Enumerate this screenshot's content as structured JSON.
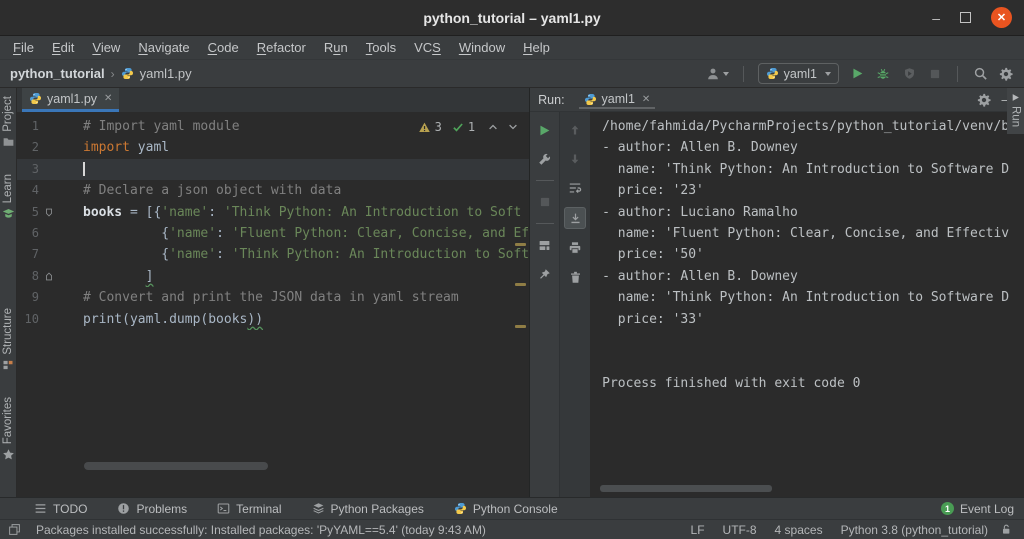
{
  "window": {
    "title": "python_tutorial – yaml1.py"
  },
  "icons_text": {
    "close": "✕",
    "win_min": "–",
    "win_close": "✕",
    "minimize": "—"
  },
  "colors": {
    "accent_blue": "#3a76b8",
    "ubuntu_orange": "#e95420",
    "run_green": "#59a869",
    "keyword_orange": "#cc7832",
    "string_green": "#6a8759",
    "comment_gray": "#808080",
    "warning_tan": "#b8a14f",
    "event_green": "#499c54"
  },
  "menu": {
    "items": [
      {
        "label": "File",
        "mnemonic_index": 0
      },
      {
        "label": "Edit",
        "mnemonic_index": 0
      },
      {
        "label": "View",
        "mnemonic_index": 0
      },
      {
        "label": "Navigate",
        "mnemonic_index": 0
      },
      {
        "label": "Code",
        "mnemonic_index": 0
      },
      {
        "label": "Refactor",
        "mnemonic_index": 0
      },
      {
        "label": "Run",
        "mnemonic_index": 1
      },
      {
        "label": "Tools",
        "mnemonic_index": 0
      },
      {
        "label": "VCS",
        "mnemonic_index": 2
      },
      {
        "label": "Window",
        "mnemonic_index": 0
      },
      {
        "label": "Help",
        "mnemonic_index": 0
      }
    ]
  },
  "toolbar": {
    "breadcrumb_project": "python_tutorial",
    "breadcrumb_separator": "›",
    "breadcrumb_file": "yaml1.py",
    "run_config": "yaml1"
  },
  "left_stripe": {
    "top": [
      {
        "icon": "folder",
        "label": "Project"
      },
      {
        "icon": "learn",
        "label": "Learn"
      }
    ],
    "bottom": [
      {
        "icon": "structure",
        "label": "Structure"
      },
      {
        "icon": "star",
        "label": "Favorites"
      }
    ]
  },
  "right_stripe": {
    "icon": "run-play-small",
    "label": "Run"
  },
  "editor": {
    "tab": "yaml1.py",
    "inspections": {
      "warnings": "3",
      "typos": "1"
    },
    "lines": [
      {
        "n": "1",
        "seg": [
          [
            "comment",
            "# Import yaml module"
          ]
        ]
      },
      {
        "n": "2",
        "seg": [
          [
            "keyword",
            "import"
          ],
          [
            "text",
            " yaml"
          ]
        ]
      },
      {
        "n": "3",
        "seg": [],
        "caret": true
      },
      {
        "n": "4",
        "seg": [
          [
            "comment",
            "# Declare a json object with data"
          ]
        ]
      },
      {
        "n": "5",
        "seg": [
          [
            "ident",
            "books"
          ],
          [
            "text",
            " = [{"
          ],
          [
            "string",
            "'name'"
          ],
          [
            "text",
            ": "
          ],
          [
            "string",
            "'Think Python: An Introduction to Soft"
          ]
        ],
        "fold": "start"
      },
      {
        "n": "6",
        "seg": [
          [
            "text",
            "          {"
          ],
          [
            "string",
            "'name'"
          ],
          [
            "text",
            ": "
          ],
          [
            "string",
            "'Fluent Python: Clear, Concise, and Ef"
          ]
        ]
      },
      {
        "n": "7",
        "seg": [
          [
            "text",
            "          {"
          ],
          [
            "string",
            "'name'"
          ],
          [
            "text",
            ": "
          ],
          [
            "string",
            "'Think Python: An Introduction to Soft"
          ]
        ]
      },
      {
        "n": "8",
        "seg": [
          [
            "text",
            "        "
          ],
          [
            "typo",
            "]"
          ]
        ],
        "fold": "end"
      },
      {
        "n": "9",
        "seg": [
          [
            "comment",
            "# Convert and print the JSON data in yaml stream"
          ]
        ]
      },
      {
        "n": "10",
        "seg": [
          [
            "text",
            "print(yaml.dump(books"
          ],
          [
            "typo",
            "))"
          ]
        ]
      }
    ]
  },
  "run_panel": {
    "label": "Run:",
    "tab": "yaml1",
    "toolbar_main": [
      {
        "icon": "rerun"
      },
      {
        "icon": "wrench"
      },
      {
        "divider": true
      },
      {
        "icon": "stop",
        "disabled": true
      },
      {
        "divider": true
      },
      {
        "icon": "restore-layout"
      },
      {
        "icon": "pin"
      }
    ],
    "toolbar_console": [
      {
        "icon": "arrow-up",
        "disabled": true
      },
      {
        "icon": "arrow-down",
        "disabled": true
      },
      {
        "icon": "soft-wrap"
      },
      {
        "icon": "scroll-end",
        "selected": true
      },
      {
        "icon": "print"
      },
      {
        "icon": "clear"
      }
    ],
    "output": [
      "/home/fahmida/PycharmProjects/python_tutorial/venv/b",
      "- author: Allen B. Downey",
      "  name: 'Think Python: An Introduction to Software D",
      "  price: '23'",
      "- author: Luciano Ramalho",
      "  name: 'Fluent Python: Clear, Concise, and Effectiv",
      "  price: '50'",
      "- author: Allen B. Downey",
      "  name: 'Think Python: An Introduction to Software D",
      "  price: '33'",
      "",
      "",
      "Process finished with exit code 0"
    ]
  },
  "bottom_bar": {
    "items": [
      {
        "icon": "todo",
        "label": "TODO"
      },
      {
        "icon": "problems",
        "label": "Problems"
      },
      {
        "icon": "terminal",
        "label": "Terminal"
      },
      {
        "icon": "packages",
        "label": "Python Packages"
      },
      {
        "icon": "python",
        "label": "Python Console"
      }
    ],
    "event_log": "Event Log",
    "event_badge": "1"
  },
  "status_bar": {
    "message": "Packages installed successfully: Installed packages: 'PyYAML==5.4' (today 9:43 AM)",
    "line_ending": "LF",
    "encoding": "UTF-8",
    "indent": "4 spaces",
    "interpreter": "Python 3.8 (python_tutorial)"
  }
}
